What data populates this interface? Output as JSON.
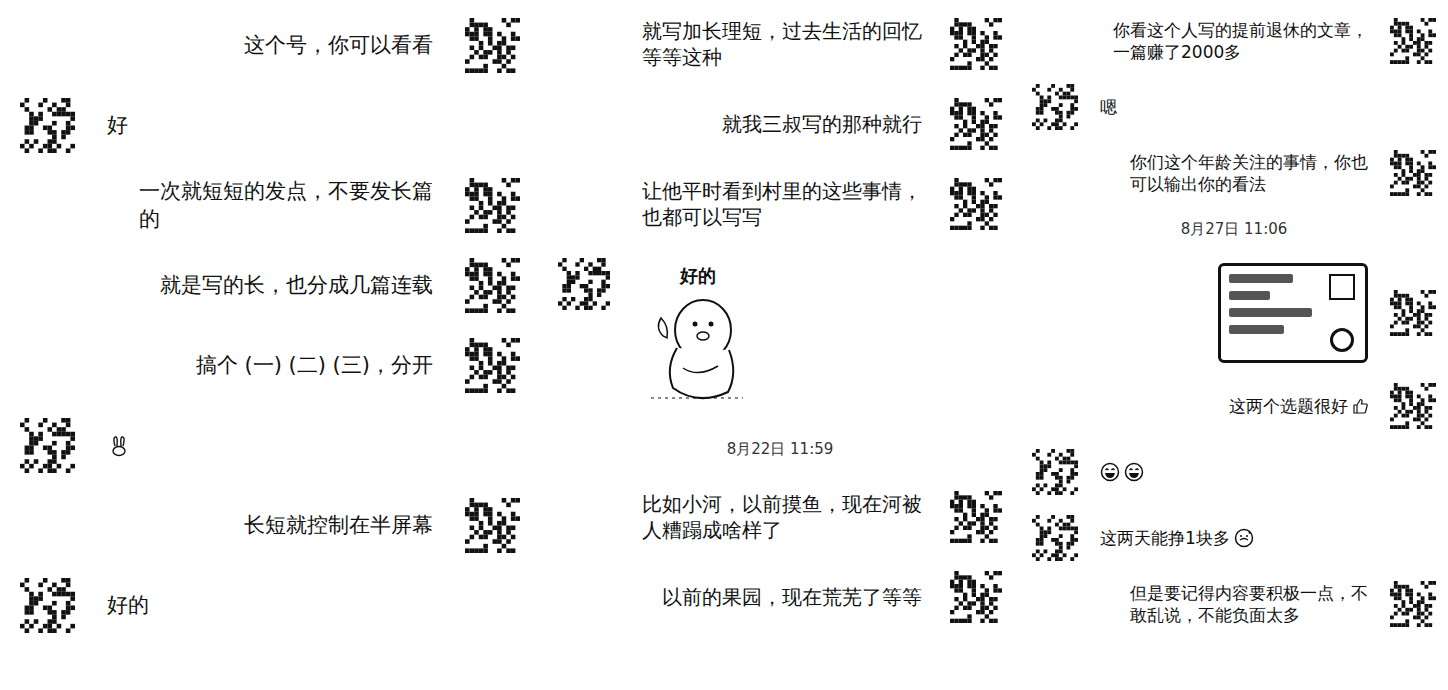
{
  "columns": [
    {
      "messages": [
        {
          "kind": "text",
          "mine": true,
          "text": "这个号，你可以看看"
        },
        {
          "kind": "text",
          "mine": false,
          "text": "好"
        },
        {
          "kind": "text",
          "mine": true,
          "text": "一次就短短的发点，不要发长篇\n的"
        },
        {
          "kind": "text",
          "mine": true,
          "text": "就是写的长，也分成几篇连载"
        },
        {
          "kind": "text",
          "mine": true,
          "text": "搞个 (一) (二) (三)，分开"
        },
        {
          "kind": "rabbit",
          "mine": false
        },
        {
          "kind": "text",
          "mine": true,
          "text": "长短就控制在半屏幕"
        },
        {
          "kind": "text",
          "mine": false,
          "text": "好的"
        }
      ]
    },
    {
      "messages": [
        {
          "kind": "text",
          "mine": true,
          "text": "就写加长理短，过去生活的回忆\n等等这种"
        },
        {
          "kind": "text",
          "mine": true,
          "text": "就我三叔写的那种就行"
        },
        {
          "kind": "text",
          "mine": true,
          "text": "让他平时看到村里的这些事情，\n也都可以写写"
        },
        {
          "kind": "sticker",
          "mine": false,
          "text": "好的"
        },
        {
          "kind": "time",
          "text": "8月22日 11:59"
        },
        {
          "kind": "text",
          "mine": true,
          "text": "比如小河，以前摸鱼，现在河被\n人糟蹋成啥样了"
        },
        {
          "kind": "text",
          "mine": true,
          "text": "以前的果园，现在荒芜了等等"
        }
      ]
    },
    {
      "messages": [
        {
          "kind": "text",
          "mine": true,
          "text": "你看这个人写的提前退休的文章，\n一篇赚了2000多"
        },
        {
          "kind": "text",
          "mine": false,
          "text": "嗯"
        },
        {
          "kind": "text",
          "mine": true,
          "text": "你们这个年龄关注的事情，你也\n可以输出你的看法"
        },
        {
          "kind": "time",
          "text": "8月27日 11:06"
        },
        {
          "kind": "image",
          "mine": true
        },
        {
          "kind": "text",
          "mine": true,
          "text": "这两个选题很好",
          "tail": "thumb"
        },
        {
          "kind": "grins",
          "mine": false
        },
        {
          "kind": "text",
          "mine": false,
          "text": "这两天能挣1块多",
          "tail": "sweat"
        },
        {
          "kind": "text",
          "mine": true,
          "text": "但是要记得内容要积极一点，不\n敢乱说，不能负面太多"
        }
      ]
    }
  ]
}
